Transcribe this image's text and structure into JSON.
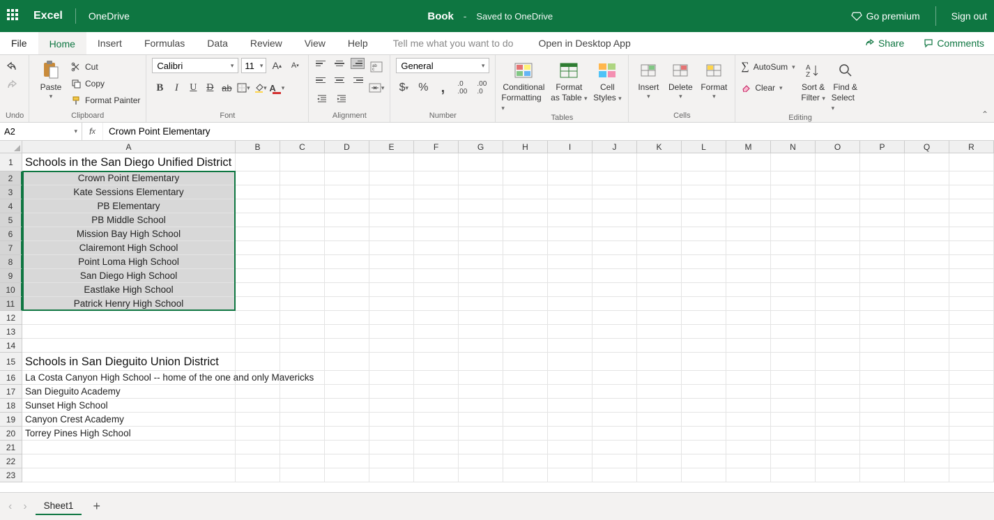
{
  "titlebar": {
    "app": "Excel",
    "location": "OneDrive",
    "bookname": "Book",
    "dash": "-",
    "saved": "Saved to OneDrive",
    "premium": "Go premium",
    "signout": "Sign out"
  },
  "menu": {
    "file": "File",
    "home": "Home",
    "insert": "Insert",
    "formulas": "Formulas",
    "data": "Data",
    "review": "Review",
    "view": "View",
    "help": "Help",
    "tellme": "Tell me what you want to do",
    "openapp": "Open in Desktop App",
    "share": "Share",
    "comments": "Comments"
  },
  "ribbon": {
    "undo_label": "Undo",
    "clipboard": {
      "paste": "Paste",
      "cut": "Cut",
      "copy": "Copy",
      "painter": "Format Painter",
      "label": "Clipboard"
    },
    "font": {
      "name": "Calibri",
      "size": "11",
      "label": "Font"
    },
    "alignment": {
      "label": "Alignment"
    },
    "number": {
      "format": "General",
      "label": "Number"
    },
    "tables": {
      "cond1": "Conditional",
      "cond2": "Formatting",
      "fat1": "Format",
      "fat2": "as Table",
      "cs1": "Cell",
      "cs2": "Styles",
      "label": "Tables"
    },
    "cells": {
      "insert": "Insert",
      "delete": "Delete",
      "format": "Format",
      "label": "Cells"
    },
    "editing": {
      "autosum": "AutoSum",
      "clear": "Clear",
      "sort1": "Sort &",
      "sort2": "Filter",
      "find1": "Find &",
      "find2": "Select",
      "label": "Editing"
    }
  },
  "formula": {
    "namebox": "A2",
    "value": "Crown Point Elementary"
  },
  "columns": [
    "A",
    "B",
    "C",
    "D",
    "E",
    "F",
    "G",
    "H",
    "I",
    "J",
    "K",
    "L",
    "M",
    "N",
    "O",
    "P",
    "Q",
    "R"
  ],
  "rows": [
    {
      "n": 1,
      "big": true,
      "a": "Schools in the San Diego Unified District",
      "heading": true,
      "sel": false
    },
    {
      "n": 2,
      "big": false,
      "a": "Crown Point Elementary",
      "center": true,
      "sel": true
    },
    {
      "n": 3,
      "big": false,
      "a": "Kate Sessions Elementary",
      "center": true,
      "sel": true
    },
    {
      "n": 4,
      "big": false,
      "a": "PB Elementary",
      "center": true,
      "sel": true
    },
    {
      "n": 5,
      "big": false,
      "a": "PB Middle School",
      "center": true,
      "sel": true
    },
    {
      "n": 6,
      "big": false,
      "a": "Mission Bay High School",
      "center": true,
      "sel": true
    },
    {
      "n": 7,
      "big": false,
      "a": "Clairemont High School",
      "center": true,
      "sel": true
    },
    {
      "n": 8,
      "big": false,
      "a": "Point Loma High School",
      "center": true,
      "sel": true
    },
    {
      "n": 9,
      "big": false,
      "a": "San Diego High School",
      "center": true,
      "sel": true
    },
    {
      "n": 10,
      "big": false,
      "a": "Eastlake High School",
      "center": true,
      "sel": true
    },
    {
      "n": 11,
      "big": false,
      "a": "Patrick Henry High School",
      "center": true,
      "sel": true
    },
    {
      "n": 12,
      "big": false,
      "a": ""
    },
    {
      "n": 13,
      "big": false,
      "a": ""
    },
    {
      "n": 14,
      "big": false,
      "a": ""
    },
    {
      "n": 15,
      "big": true,
      "a": "Schools in San Dieguito Union District",
      "heading": true
    },
    {
      "n": 16,
      "big": false,
      "a": "La Costa Canyon High School -- home of the one and only Mavericks",
      "overflow": true
    },
    {
      "n": 17,
      "big": false,
      "a": "San Dieguito Academy"
    },
    {
      "n": 18,
      "big": false,
      "a": "Sunset High School"
    },
    {
      "n": 19,
      "big": false,
      "a": "Canyon Crest Academy"
    },
    {
      "n": 20,
      "big": false,
      "a": "Torrey Pines High School"
    },
    {
      "n": 21,
      "big": false,
      "a": ""
    },
    {
      "n": 22,
      "big": false,
      "a": ""
    },
    {
      "n": 23,
      "big": false,
      "a": ""
    }
  ],
  "sheetbar": {
    "sheet1": "Sheet1"
  },
  "selection": {
    "top_row_index": 1,
    "bottom_row_index": 10
  }
}
